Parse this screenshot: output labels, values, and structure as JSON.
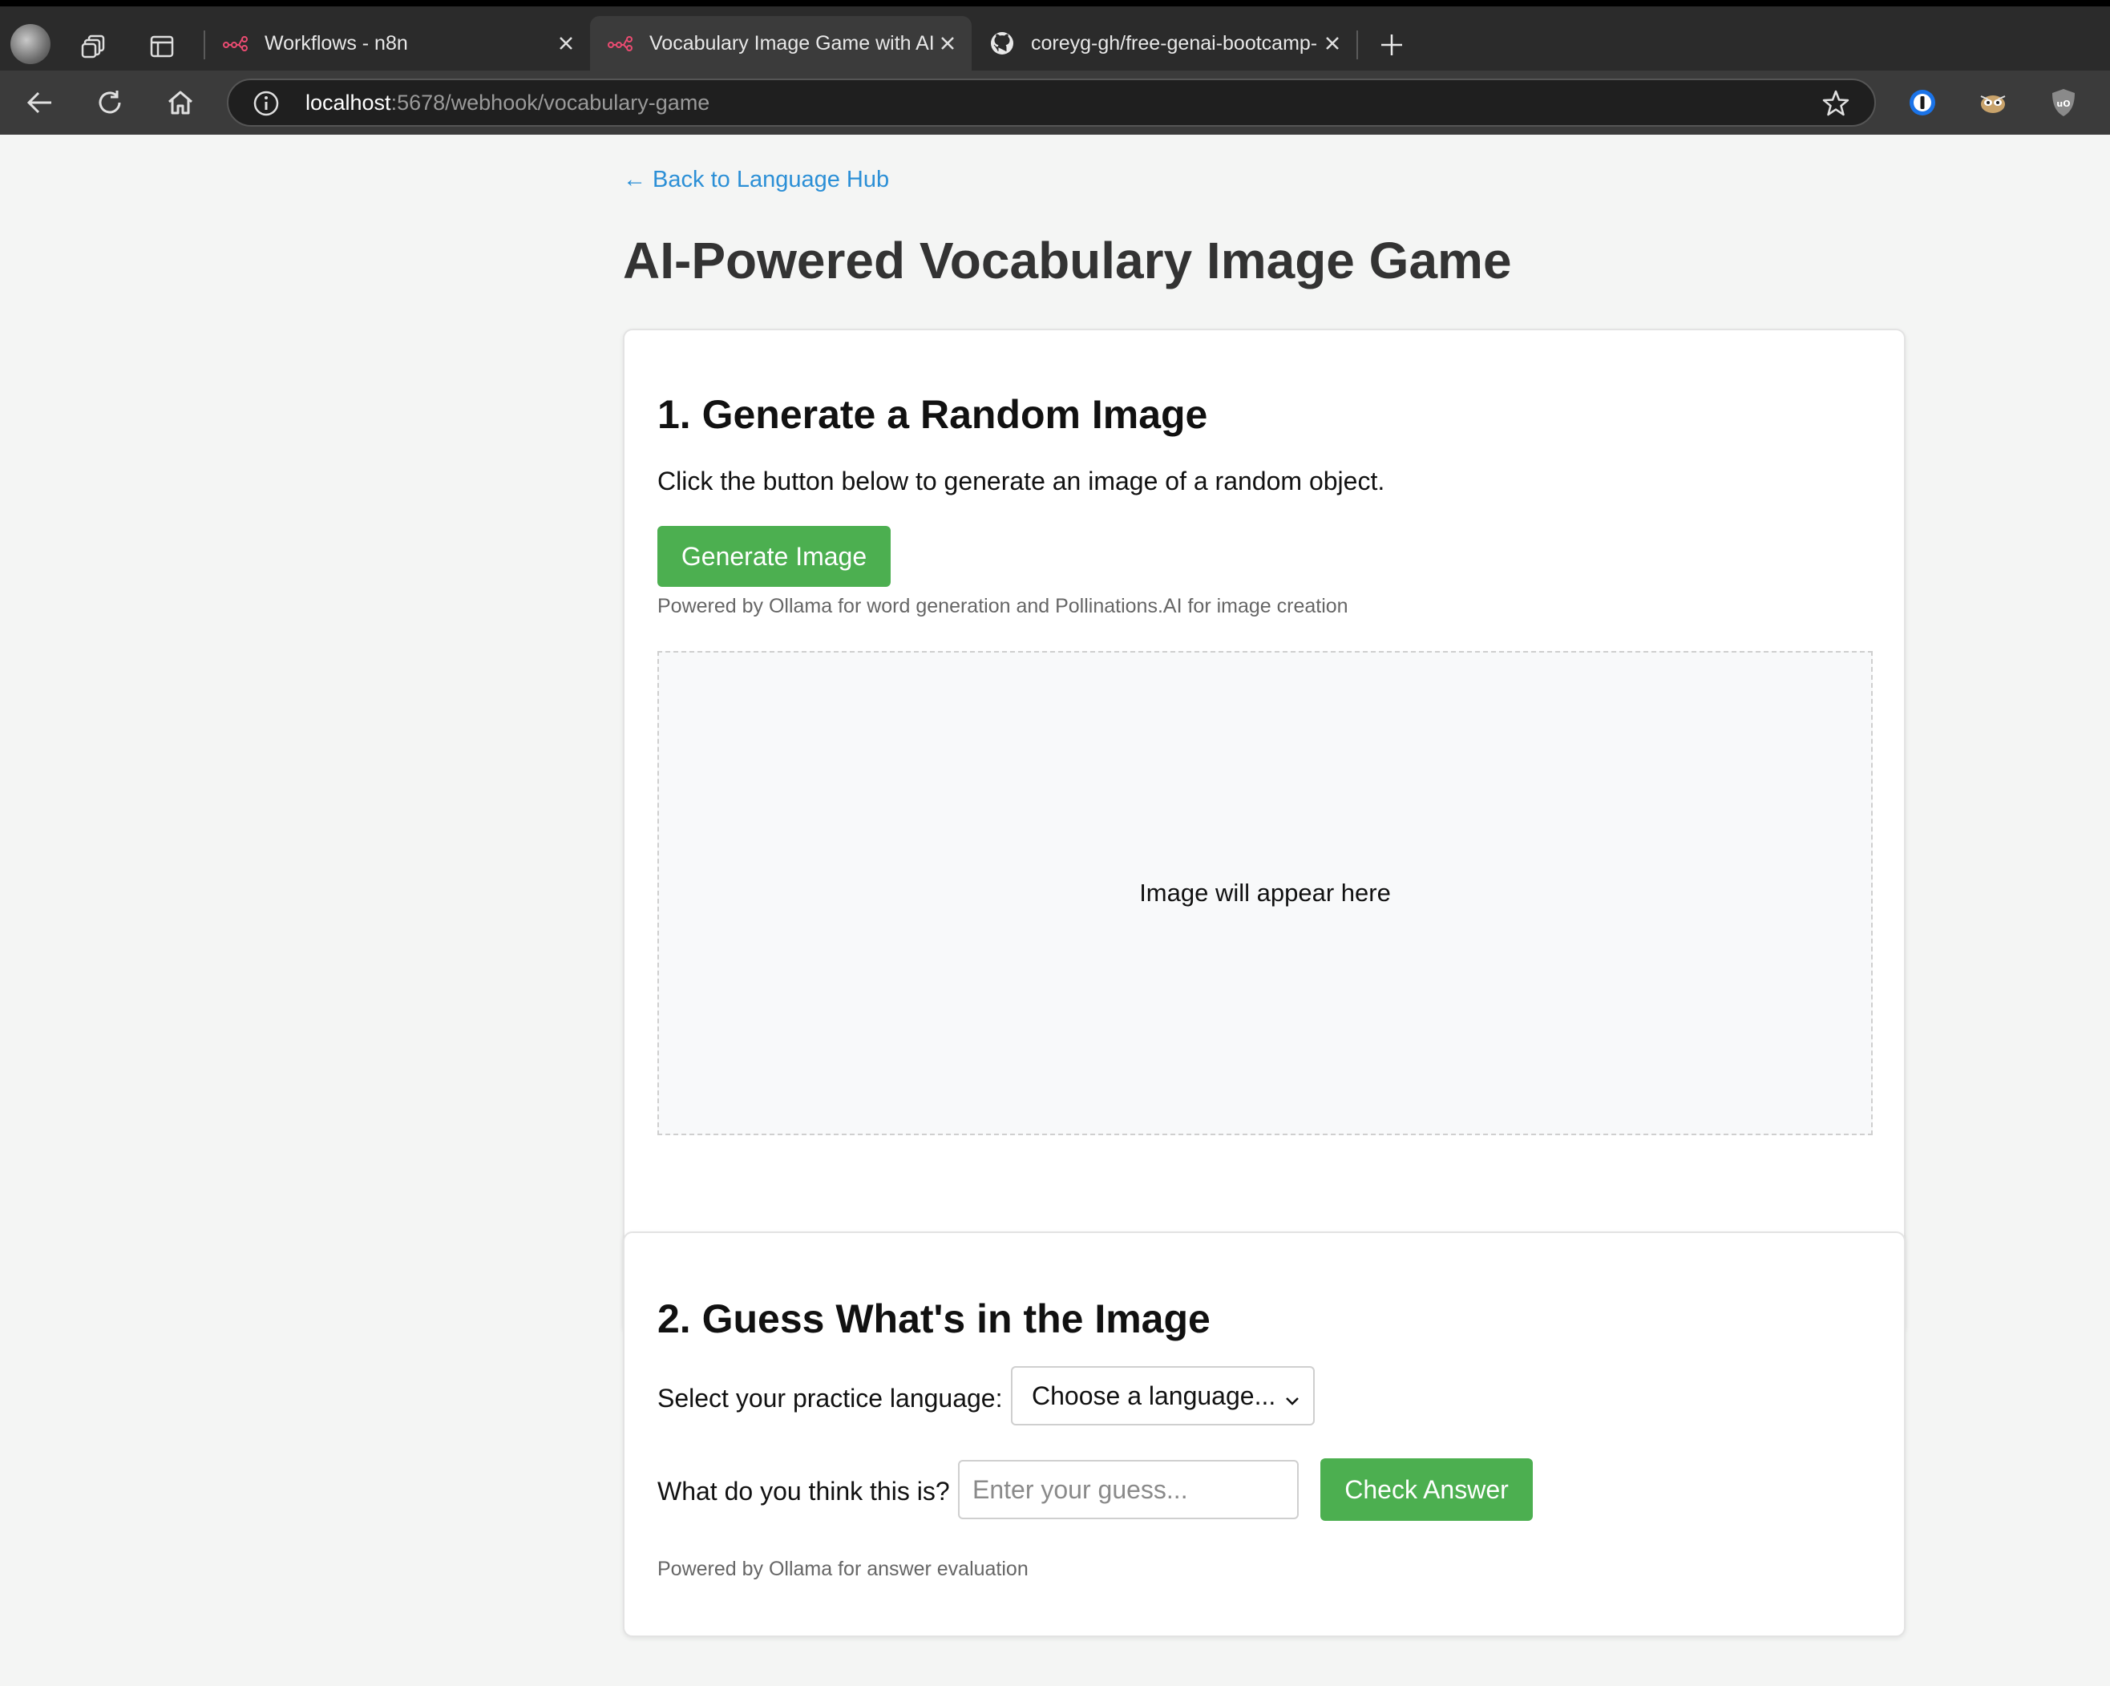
{
  "browser": {
    "tabs": [
      {
        "title": "Workflows - n8n",
        "active": false
      },
      {
        "title": "Vocabulary Image Game with AI",
        "active": true
      },
      {
        "title": "coreyg-gh/free-genai-bootcamp-",
        "active": false
      }
    ],
    "address": {
      "host": "localhost",
      "path": ":5678/webhook/vocabulary-game"
    }
  },
  "page": {
    "back_link": "← Back to Language Hub",
    "title": "AI-Powered Vocabulary Image Game"
  },
  "section1": {
    "heading": "1. Generate a Random Image",
    "instruction": "Click the button below to generate an image of a random object.",
    "button_label": "Generate Image",
    "note": "Powered by Ollama for word generation and Pollinations.AI for image creation",
    "image_placeholder": "Image will appear here"
  },
  "section2": {
    "heading": "2. Guess What's in the Image",
    "language_label": "Select your practice language:",
    "language_selected": "Choose a language...",
    "guess_label": "What do you think this is?",
    "guess_placeholder": "Enter your guess...",
    "check_label": "Check Answer",
    "note": "Powered by Ollama for answer evaluation"
  },
  "colors": {
    "accent_green": "#4caf50",
    "link_blue": "#2b8fd6",
    "n8n_red": "#ea4b71"
  }
}
